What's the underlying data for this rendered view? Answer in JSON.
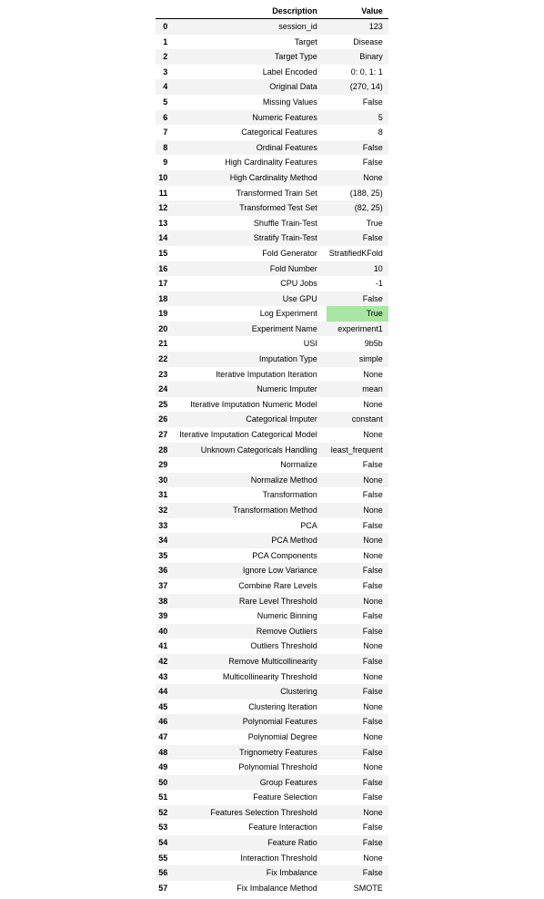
{
  "table": {
    "headers": {
      "idx": "",
      "desc": "Description",
      "val": "Value"
    },
    "rows": [
      {
        "idx": "0",
        "desc": "session_id",
        "val": "123"
      },
      {
        "idx": "1",
        "desc": "Target",
        "val": "Disease"
      },
      {
        "idx": "2",
        "desc": "Target Type",
        "val": "Binary"
      },
      {
        "idx": "3",
        "desc": "Label Encoded",
        "val": "0: 0, 1: 1"
      },
      {
        "idx": "4",
        "desc": "Original Data",
        "val": "(270, 14)"
      },
      {
        "idx": "5",
        "desc": "Missing Values",
        "val": "False"
      },
      {
        "idx": "6",
        "desc": "Numeric Features",
        "val": "5"
      },
      {
        "idx": "7",
        "desc": "Categorical Features",
        "val": "8"
      },
      {
        "idx": "8",
        "desc": "Ordinal Features",
        "val": "False"
      },
      {
        "idx": "9",
        "desc": "High Cardinality Features",
        "val": "False"
      },
      {
        "idx": "10",
        "desc": "High Cardinality Method",
        "val": "None"
      },
      {
        "idx": "11",
        "desc": "Transformed Train Set",
        "val": "(188, 25)"
      },
      {
        "idx": "12",
        "desc": "Transformed Test Set",
        "val": "(82, 25)"
      },
      {
        "idx": "13",
        "desc": "Shuffle Train-Test",
        "val": "True"
      },
      {
        "idx": "14",
        "desc": "Stratify Train-Test",
        "val": "False"
      },
      {
        "idx": "15",
        "desc": "Fold Generator",
        "val": "StratifiedKFold"
      },
      {
        "idx": "16",
        "desc": "Fold Number",
        "val": "10"
      },
      {
        "idx": "17",
        "desc": "CPU Jobs",
        "val": "-1"
      },
      {
        "idx": "18",
        "desc": "Use GPU",
        "val": "False"
      },
      {
        "idx": "19",
        "desc": "Log Experiment",
        "val": "True",
        "highlight": true
      },
      {
        "idx": "20",
        "desc": "Experiment Name",
        "val": "experiment1"
      },
      {
        "idx": "21",
        "desc": "USI",
        "val": "9b5b"
      },
      {
        "idx": "22",
        "desc": "Imputation Type",
        "val": "simple"
      },
      {
        "idx": "23",
        "desc": "Iterative Imputation Iteration",
        "val": "None"
      },
      {
        "idx": "24",
        "desc": "Numeric Imputer",
        "val": "mean"
      },
      {
        "idx": "25",
        "desc": "Iterative Imputation Numeric Model",
        "val": "None"
      },
      {
        "idx": "26",
        "desc": "Categorical Imputer",
        "val": "constant"
      },
      {
        "idx": "27",
        "desc": "Iterative Imputation Categorical Model",
        "val": "None"
      },
      {
        "idx": "28",
        "desc": "Unknown Categoricals Handling",
        "val": "least_frequent"
      },
      {
        "idx": "29",
        "desc": "Normalize",
        "val": "False"
      },
      {
        "idx": "30",
        "desc": "Normalize Method",
        "val": "None"
      },
      {
        "idx": "31",
        "desc": "Transformation",
        "val": "False"
      },
      {
        "idx": "32",
        "desc": "Transformation Method",
        "val": "None"
      },
      {
        "idx": "33",
        "desc": "PCA",
        "val": "False"
      },
      {
        "idx": "34",
        "desc": "PCA Method",
        "val": "None"
      },
      {
        "idx": "35",
        "desc": "PCA Components",
        "val": "None"
      },
      {
        "idx": "36",
        "desc": "Ignore Low Variance",
        "val": "False"
      },
      {
        "idx": "37",
        "desc": "Combine Rare Levels",
        "val": "False"
      },
      {
        "idx": "38",
        "desc": "Rare Level Threshold",
        "val": "None"
      },
      {
        "idx": "39",
        "desc": "Numeric Binning",
        "val": "False"
      },
      {
        "idx": "40",
        "desc": "Remove Outliers",
        "val": "False"
      },
      {
        "idx": "41",
        "desc": "Outliers Threshold",
        "val": "None"
      },
      {
        "idx": "42",
        "desc": "Remove Multicollinearity",
        "val": "False"
      },
      {
        "idx": "43",
        "desc": "Multicollinearity Threshold",
        "val": "None"
      },
      {
        "idx": "44",
        "desc": "Clustering",
        "val": "False"
      },
      {
        "idx": "45",
        "desc": "Clustering Iteration",
        "val": "None"
      },
      {
        "idx": "46",
        "desc": "Polynomial Features",
        "val": "False"
      },
      {
        "idx": "47",
        "desc": "Polynomial Degree",
        "val": "None"
      },
      {
        "idx": "48",
        "desc": "Trignometry Features",
        "val": "False"
      },
      {
        "idx": "49",
        "desc": "Polynomial Threshold",
        "val": "None"
      },
      {
        "idx": "50",
        "desc": "Group Features",
        "val": "False"
      },
      {
        "idx": "51",
        "desc": "Feature Selection",
        "val": "False"
      },
      {
        "idx": "52",
        "desc": "Features Selection Threshold",
        "val": "None"
      },
      {
        "idx": "53",
        "desc": "Feature Interaction",
        "val": "False"
      },
      {
        "idx": "54",
        "desc": "Feature Ratio",
        "val": "False"
      },
      {
        "idx": "55",
        "desc": "Interaction Threshold",
        "val": "None"
      },
      {
        "idx": "56",
        "desc": "Fix Imbalance",
        "val": "False"
      },
      {
        "idx": "57",
        "desc": "Fix Imbalance Method",
        "val": "SMOTE"
      }
    ]
  }
}
